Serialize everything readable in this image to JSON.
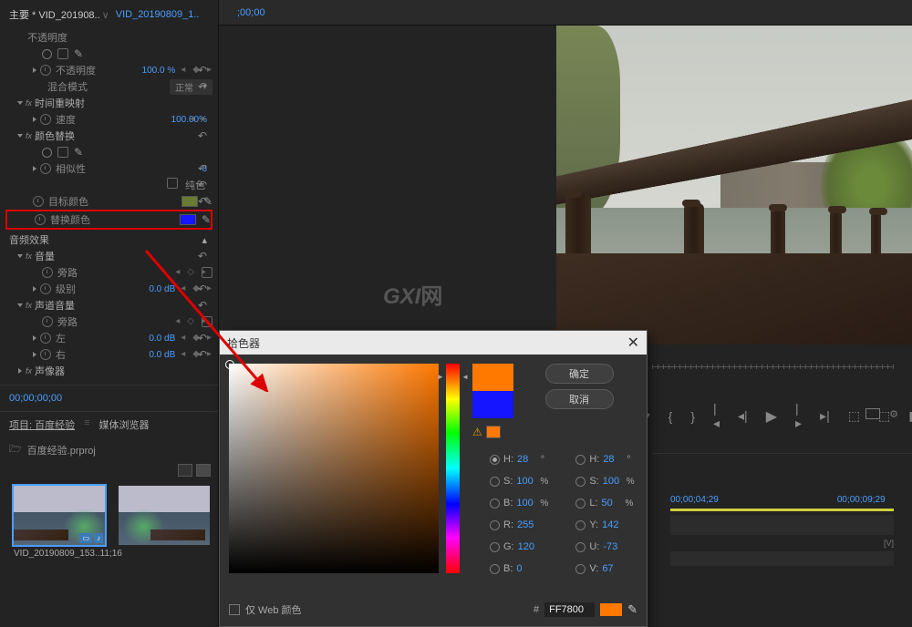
{
  "tabs": {
    "main": "主要 * VID_201908..",
    "active": "VID_20190809_1.."
  },
  "effects": {
    "opacity_header": "不透明度",
    "opacity": {
      "label": "不透明度",
      "value": "100.0 %"
    },
    "blend": {
      "label": "混合模式",
      "value": "正常"
    },
    "time_remap": "时间重映射",
    "speed": {
      "label": "速度",
      "value": "100.00%"
    },
    "color_replace": "颜色替换",
    "similarity": {
      "label": "相似性",
      "value": "8"
    },
    "solid_color": {
      "label": "纯色"
    },
    "target_color": {
      "label": "目标颜色",
      "swatch": "#6a7a30"
    },
    "replace_color": {
      "label": "替换颜色",
      "swatch": "#1515ff"
    },
    "audio_section": "音频效果",
    "volume": "音量",
    "bypass": {
      "label": "旁路"
    },
    "level": {
      "label": "级别",
      "value": "0.0 dB"
    },
    "channel_vol": "声道音量",
    "left": {
      "label": "左",
      "value": "0.0 dB"
    },
    "right": {
      "label": "右",
      "value": "0.0 dB"
    },
    "pan": "声像器"
  },
  "timecode": "00;00;00;00",
  "project": {
    "tab1": "项目: 百度经验",
    "tab2": "媒体浏览器",
    "filename": "百度经验.prproj",
    "clip1_name": "VID_20190809_153..",
    "clip1_dur": "11;16"
  },
  "watermark": {
    "main": "GXI",
    "suffix": "网"
  },
  "color_picker": {
    "title": "拾色器",
    "ok": "确定",
    "cancel": "取消",
    "channels": {
      "H": {
        "label": "H:",
        "value": "28",
        "unit": "°"
      },
      "S": {
        "label": "S:",
        "value": "100",
        "unit": "%"
      },
      "B": {
        "label": "B:",
        "value": "100",
        "unit": "%"
      },
      "R": {
        "label": "R:",
        "value": "255"
      },
      "G": {
        "label": "G:",
        "value": "120"
      },
      "Bb": {
        "label": "B:",
        "value": "0"
      },
      "H2": {
        "label": "H:",
        "value": "28",
        "unit": "°"
      },
      "S2": {
        "label": "S:",
        "value": "100",
        "unit": "%"
      },
      "L": {
        "label": "L:",
        "value": "50",
        "unit": "%"
      },
      "Y": {
        "label": "Y:",
        "value": "142"
      },
      "U": {
        "label": "U:",
        "value": "-73"
      },
      "V": {
        "label": "V:",
        "value": "67"
      }
    },
    "web_only": "仅 Web 颜色",
    "hex_label": "#",
    "hex_value": "FF7800"
  },
  "timeline": {
    "start_tc": ";00;00",
    "tc1": "00;00;04;29",
    "tc2": "00;00;09;29"
  }
}
